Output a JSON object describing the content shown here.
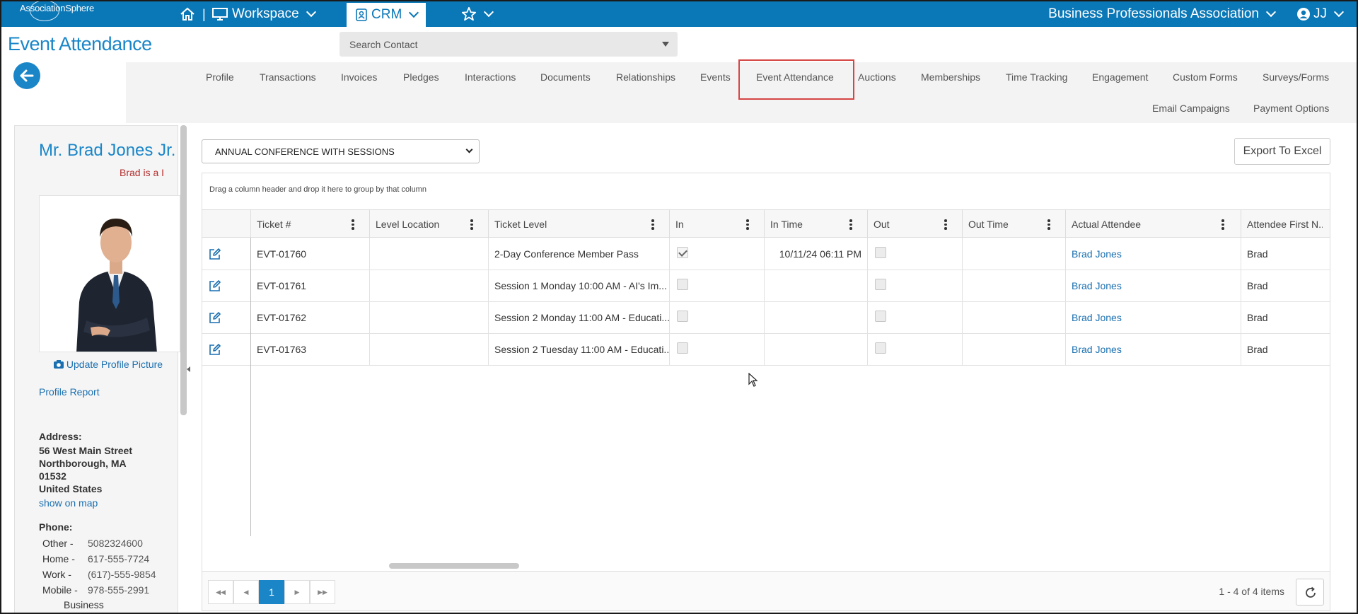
{
  "topbar": {
    "logo_text": "AssociationSphere",
    "workspace_label": "Workspace",
    "crm_label": "CRM",
    "org_name": "Business Professionals Association",
    "user_initials": "JJ",
    "brand_color": "#0a77b7"
  },
  "page": {
    "title": "Event Attendance",
    "search_placeholder": "Search Contact"
  },
  "tabs": [
    {
      "label": "Profile"
    },
    {
      "label": "Transactions"
    },
    {
      "label": "Invoices"
    },
    {
      "label": "Pledges"
    },
    {
      "label": "Interactions"
    },
    {
      "label": "Documents"
    },
    {
      "label": "Relationships"
    },
    {
      "label": "Events"
    },
    {
      "label": "Event Attendance",
      "active": true
    },
    {
      "label": "Auctions"
    },
    {
      "label": "Memberships"
    },
    {
      "label": "Time Tracking"
    },
    {
      "label": "Engagement"
    },
    {
      "label": "Custom Forms"
    },
    {
      "label": "Surveys/Forms"
    },
    {
      "label": "Email Campaigns"
    },
    {
      "label": "Payment Options"
    }
  ],
  "profile": {
    "name": "Mr. Brad Jones Jr.",
    "note": "Brad is a I",
    "update_picture_label": "Update Profile Picture",
    "profile_report_label": "Profile Report",
    "address_label": "Address:",
    "address_lines": [
      "56 West Main Street",
      "Northborough, MA",
      "01532",
      "United States"
    ],
    "show_on_map_label": "show on map",
    "phone_label": "Phone:",
    "phones": [
      {
        "type": "Other -",
        "value": "5082324600"
      },
      {
        "type": "Home -",
        "value": "617-555-7724"
      },
      {
        "type": "Work -",
        "value": "(617)-555-9854"
      },
      {
        "type": "Mobile -",
        "value": "978-555-2991"
      },
      {
        "type": "Business",
        "value": ""
      }
    ]
  },
  "event_select": {
    "selected": "ANNUAL CONFERENCE WITH SESSIONS"
  },
  "export_label": "Export To Excel",
  "grid": {
    "group_hint": "Drag a column header and drop it here to group by that column",
    "columns": [
      "Ticket #",
      "Level Location",
      "Ticket Level",
      "In",
      "In Time",
      "Out",
      "Out Time",
      "Actual Attendee",
      "Attendee First N..."
    ],
    "rows": [
      {
        "ticket": "EVT-01760",
        "level_location": "",
        "ticket_level": "2-Day Conference Member Pass",
        "in": true,
        "in_time": "10/11/24 06:11 PM",
        "out": false,
        "out_time": "",
        "attendee": "Brad Jones",
        "first_name": "Brad"
      },
      {
        "ticket": "EVT-01761",
        "level_location": "",
        "ticket_level": "Session 1 Monday 10:00 AM - AI's Im...",
        "in": false,
        "in_time": "",
        "out": false,
        "out_time": "",
        "attendee": "Brad Jones",
        "first_name": "Brad"
      },
      {
        "ticket": "EVT-01762",
        "level_location": "",
        "ticket_level": "Session 2 Monday 11:00 AM - Educati...",
        "in": false,
        "in_time": "",
        "out": false,
        "out_time": "",
        "attendee": "Brad Jones",
        "first_name": "Brad"
      },
      {
        "ticket": "EVT-01763",
        "level_location": "",
        "ticket_level": "Session 2 Tuesday 11:00 AM - Educati...",
        "in": false,
        "in_time": "",
        "out": false,
        "out_time": "",
        "attendee": "Brad Jones",
        "first_name": "Brad"
      }
    ]
  },
  "pager": {
    "current_page": "1",
    "info": "1 - 4 of 4 items"
  }
}
